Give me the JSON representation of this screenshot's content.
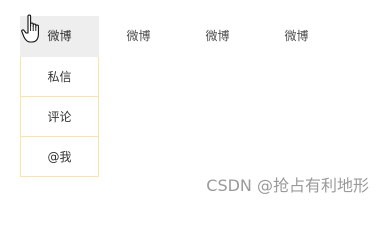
{
  "nav": {
    "items": [
      {
        "label": "微博"
      },
      {
        "label": "微博"
      },
      {
        "label": "微博"
      },
      {
        "label": "微博"
      }
    ]
  },
  "dropdown": {
    "items": [
      {
        "label": "私信"
      },
      {
        "label": "评论"
      },
      {
        "label": "@我"
      }
    ]
  },
  "watermark": "CSDN @抢占有利地形",
  "colors": {
    "active_background": "#eeeeee",
    "dropdown_border": "#fde3a6",
    "text": "#333333",
    "watermark": "#9a9a9a"
  },
  "icons": {
    "cursor": "hand-pointer-icon"
  }
}
